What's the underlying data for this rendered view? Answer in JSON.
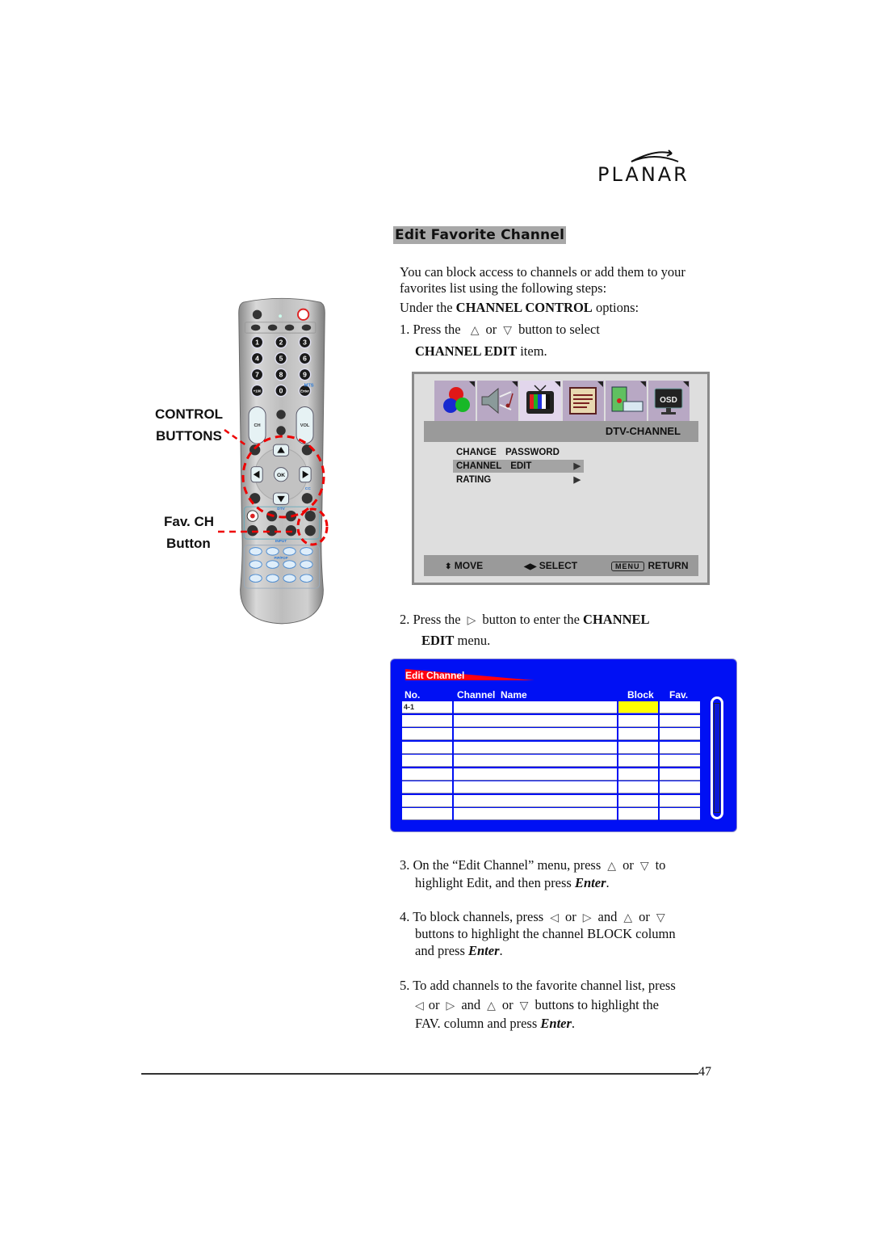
{
  "brand": {
    "logo_text": "PLANAR"
  },
  "section": {
    "title": "Edit Favorite Channel"
  },
  "intro": {
    "line1": "You can block access to channels or add them to your",
    "line2": "favorites list using the following steps:",
    "under_prefix": "Under the ",
    "under_bold": "CHANNEL CONTROL",
    "under_suffix": " options:"
  },
  "steps": {
    "s1": {
      "prefix": "1. Press the",
      "or": "or",
      "suffix": "button to select",
      "bold": "CHANNEL EDIT",
      "tail": " item."
    },
    "s2": {
      "prefix": "2.  Press the",
      "suffix": "button to enter the ",
      "bold1": "CHANNEL",
      "bold2": "EDIT",
      "tail": " menu."
    },
    "s3": {
      "prefix": "3. On the “Edit Channel” menu, press",
      "or": "or",
      "to": "to",
      "line2_prefix": "highlight Edit, and then press ",
      "enter": "Enter",
      "period": "."
    },
    "s4": {
      "prefix": "4. To block channels, press",
      "or": "or",
      "and": "and",
      "line2": "buttons to highlight the channel BLOCK column",
      "line3_prefix": "and press ",
      "enter": "Enter",
      "period": "."
    },
    "s5": {
      "line1": "5. To add channels to the favorite channel list, press",
      "or": "or",
      "and": "and",
      "suffix": "buttons to highlight the",
      "line3_prefix": "FAV. column and press ",
      "enter": "Enter",
      "period": "."
    }
  },
  "remote_labels": {
    "control": "CONTROL",
    "buttons": "BUTTONS",
    "fav_ch": "Fav. CH",
    "button": "Button"
  },
  "remote": {
    "keys_numeric": [
      "1",
      "2",
      "3",
      "4",
      "5",
      "6",
      "7",
      "8",
      "9",
      "+100",
      "0",
      "Enter"
    ],
    "mts_label": "MTS",
    "ch_label": "CH",
    "vol_label": "VOL",
    "ok_label": "OK",
    "cc_label": "CC",
    "dtv_label": "DTV",
    "input_label": "INPUT",
    "pip_label": "PIP/POP"
  },
  "osd_menu": {
    "icons": [
      "color-icon",
      "audio-icon",
      "tv-channel-icon",
      "setup-list-icon",
      "pc-keyboard-icon",
      "osd-monitor-icon"
    ],
    "active_icon_index": 2,
    "header": "DTV-CHANNEL",
    "items": [
      {
        "label": "CHANGE PASSWORD",
        "has_arrow": false,
        "selected": false
      },
      {
        "label": "CHANNEL EDIT",
        "has_arrow": true,
        "selected": true
      },
      {
        "label": "RATING",
        "has_arrow": true,
        "selected": false
      }
    ],
    "footer": {
      "move": "MOVE",
      "select": "SELECT",
      "menu_key": "MENU",
      "return": "RETURN"
    }
  },
  "edit_channel": {
    "title": "Edit Channel",
    "columns": [
      "No.",
      "Channel  Name",
      "Block",
      "Fav."
    ],
    "rows": [
      [
        "4-1",
        "",
        "",
        ""
      ],
      [
        "",
        "",
        "",
        ""
      ],
      [
        "",
        "",
        "",
        ""
      ],
      [
        "",
        "",
        "",
        ""
      ],
      [
        "",
        "",
        "",
        ""
      ],
      [
        "",
        "",
        "",
        ""
      ],
      [
        "",
        "",
        "",
        ""
      ],
      [
        "",
        "",
        "",
        ""
      ],
      [
        "",
        "",
        "",
        ""
      ]
    ],
    "highlight_color": "#ffff00",
    "panel_color": "#0010f4",
    "accent_color": "#ff0010"
  },
  "footer": {
    "page_number": "47"
  }
}
